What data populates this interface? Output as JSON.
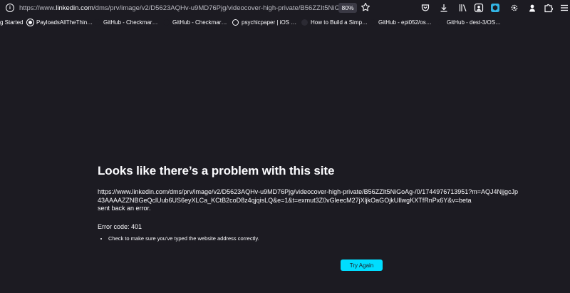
{
  "browser": {
    "url_prefix": "https://www.",
    "url_domain": "linkedin.com",
    "url_path": "/dms/prv/image/v2/D5623AQHv-u9MD76Pjg/videocover-high-private/B56ZZIt5NiG",
    "zoom": "80%"
  },
  "bookmarks": [
    {
      "label": "g Started",
      "color": "#1c1b22"
    },
    {
      "label": "PayloadsAllTheThin…",
      "color": "#fbfbfe"
    },
    {
      "label": "GitHub - Checkmar…",
      "color": "#1c1b22"
    },
    {
      "label": "GitHub - Checkmar…",
      "color": "#1c1b22"
    },
    {
      "label": "psychicpaper | iOS …",
      "color": "#fbfbfe"
    },
    {
      "label": "How to Build a Simp…",
      "color": "#2b2a33"
    },
    {
      "label": "GitHub - epi052/os…",
      "color": "#1c1b22"
    },
    {
      "label": "GitHub - dest-3/OS…",
      "color": "#1c1b22"
    }
  ],
  "error_page": {
    "title": "Looks like there’s a problem with this site",
    "url_line": "https://www.linkedin.com/dms/prv/image/v2/D5623AQHv-u9MD76Pjg/videocover-high-private/B56ZZIt5NiGoAg-/0/1744976713951?m=AQJ4NjjgcJp43AAAAZZNBGeQclUub6US6eyXLCa_KCtB2coD8z4qjqisLQ&e=1&t=exmut3Z0vGleecM27jXljkOaGOjkUIlwgKXTfRnPx6Y&v=beta",
    "sent_back": "sent back an error.",
    "error_code": "Error code: 401",
    "hints": [
      "Check to make sure you’ve typed the website address correctly."
    ],
    "try_again": "Try Again"
  },
  "colors": {
    "background": "#1c1b22",
    "accent": "#00ddff",
    "text": "#fbfbfe"
  }
}
